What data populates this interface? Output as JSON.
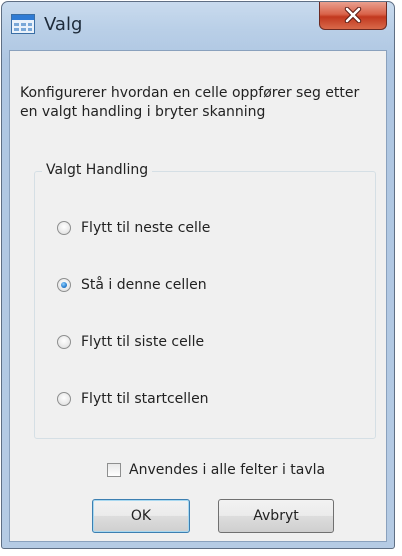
{
  "window": {
    "title": "Valg",
    "close_icon": "close-icon"
  },
  "description": "Konfigurerer hvordan en celle oppfører seg etter en valgt handling i bryter skanning",
  "group": {
    "label": "Valgt Handling",
    "options": [
      {
        "label": "Flytt til neste celle",
        "checked": false
      },
      {
        "label": "Stå i denne cellen",
        "checked": true
      },
      {
        "label": "Flytt til siste celle",
        "checked": false
      },
      {
        "label": "Flytt til startcellen",
        "checked": false
      }
    ]
  },
  "apply_all": {
    "label": "Anvendes i alle felter i tavla",
    "checked": false
  },
  "buttons": {
    "ok": "OK",
    "cancel": "Avbryt"
  },
  "colors": {
    "title_bar": "#b9cfe7",
    "close_button": "#d9634a",
    "client_bg": "#f0f0f0"
  }
}
